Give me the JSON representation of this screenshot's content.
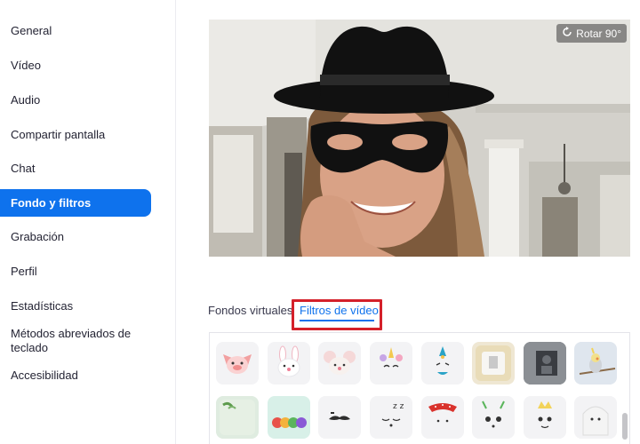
{
  "sidebar": {
    "items": [
      {
        "label": "General"
      },
      {
        "label": "Vídeo"
      },
      {
        "label": "Audio"
      },
      {
        "label": "Compartir pantalla"
      },
      {
        "label": "Chat"
      },
      {
        "label": "Fondo y filtros",
        "active": true
      },
      {
        "label": "Grabación"
      },
      {
        "label": "Perfil"
      },
      {
        "label": "Estadísticas"
      },
      {
        "label": "Métodos abreviados de teclado"
      },
      {
        "label": "Accesibilidad"
      }
    ]
  },
  "preview": {
    "rotate_label": "Rotar 90°"
  },
  "tabs": {
    "virtual_label": "Fondos virtuales",
    "video_label": "Filtros de vídeo",
    "active": "Filtros de vídeo"
  },
  "filters": [
    {
      "icon": "pig-face-icon"
    },
    {
      "icon": "bunny-face-icon"
    },
    {
      "icon": "mouse-face-icon"
    },
    {
      "icon": "unicorn-face-icon"
    },
    {
      "icon": "clown-face-icon"
    },
    {
      "icon": "tv-frame-icon"
    },
    {
      "icon": "portrait-frame-icon"
    },
    {
      "icon": "cockatiel-frame-icon"
    },
    {
      "icon": "leaves-frame-icon"
    },
    {
      "icon": "candy-frame-icon"
    },
    {
      "icon": "mustache-icon"
    },
    {
      "icon": "sleepy-face-icon"
    },
    {
      "icon": "red-bandana-icon"
    },
    {
      "icon": "antennae-face-icon"
    },
    {
      "icon": "crown-face-icon"
    },
    {
      "icon": "ghost-veil-icon"
    }
  ],
  "colors": {
    "accent": "#0e72ed",
    "highlight_border": "#d4202a",
    "sidebar_text": "#232333"
  }
}
